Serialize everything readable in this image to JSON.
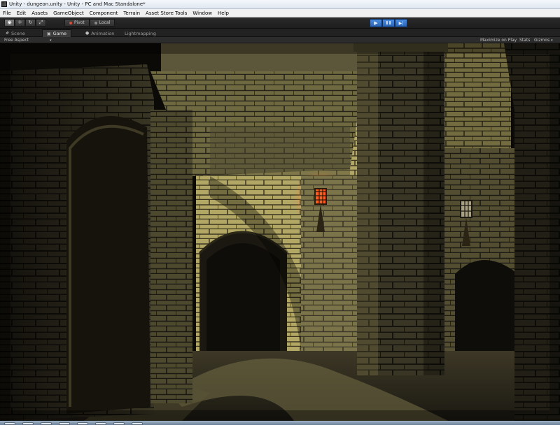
{
  "window": {
    "title": "Unity - dungeon.unity - Unity - PC and Mac Standalone*"
  },
  "menu": [
    "File",
    "Edit",
    "Assets",
    "GameObject",
    "Component",
    "Terrain",
    "Asset Store Tools",
    "Window",
    "Help"
  ],
  "toolbar": {
    "tools": [
      {
        "icon": "hand-eye-icon",
        "glyph": "◉"
      },
      {
        "icon": "move-icon",
        "glyph": "✛"
      },
      {
        "icon": "rotate-icon",
        "glyph": "↻"
      },
      {
        "icon": "scale-icon",
        "glyph": "⤢"
      }
    ],
    "pivot_label": "Pivot",
    "local_label": "Local",
    "play_glyph": "▶",
    "pause_glyph": "❚❚",
    "step_glyph": "▶|"
  },
  "tabs": {
    "scene": "Scene",
    "game": "Game",
    "animation": "Animation",
    "lightmapping": "Lightmapping"
  },
  "gamebar": {
    "aspect": "Free Aspect",
    "maximize": "Maximize on Play",
    "stats": "Stats",
    "gizmos": "Gizmos"
  },
  "colors": {
    "play_blue": "#3b78c9",
    "torch_fire": "#ff5a1f",
    "stone_lit": "#bdb272",
    "stone_dark": "#2e2b1f"
  }
}
